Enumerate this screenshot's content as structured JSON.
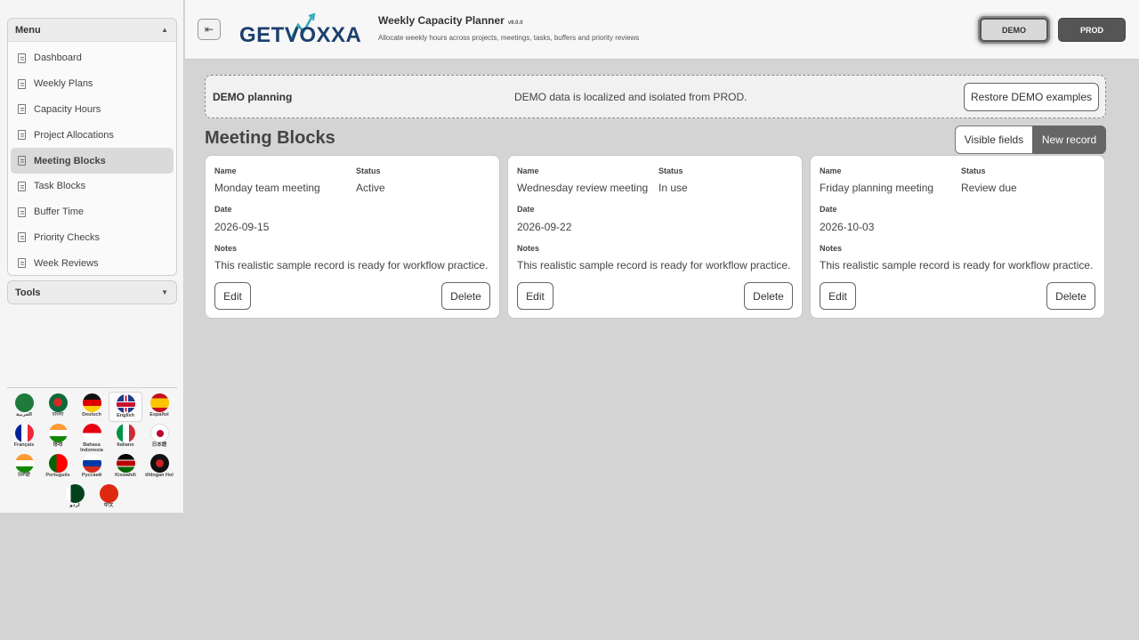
{
  "sidebar": {
    "menu_title": "Menu",
    "items": [
      {
        "label": "Dashboard"
      },
      {
        "label": "Weekly Plans"
      },
      {
        "label": "Capacity Hours"
      },
      {
        "label": "Project Allocations"
      },
      {
        "label": "Meeting Blocks",
        "active": true
      },
      {
        "label": "Task Blocks"
      },
      {
        "label": "Buffer Time"
      },
      {
        "label": "Priority Checks"
      },
      {
        "label": "Week Reviews"
      }
    ],
    "tools_title": "Tools",
    "languages": [
      {
        "name": "العربية",
        "icon": "flag-saudi-arabia-icon"
      },
      {
        "name": "বাংলা",
        "icon": "flag-bangladesh-icon"
      },
      {
        "name": "Deutsch",
        "icon": "flag-germany-icon"
      },
      {
        "name": "English",
        "icon": "flag-uk-icon",
        "selected": true
      },
      {
        "name": "Español",
        "icon": "flag-spain-icon"
      },
      {
        "name": "Français",
        "icon": "flag-france-icon"
      },
      {
        "name": "हिन्दी",
        "icon": "flag-india-icon"
      },
      {
        "name": "Bahasa Indonesia",
        "icon": "flag-indonesia-icon"
      },
      {
        "name": "Italiano",
        "icon": "flag-italy-icon"
      },
      {
        "name": "日本語",
        "icon": "flag-japan-icon"
      },
      {
        "name": "ਪੰਜਾਬੀ",
        "icon": "flag-india-icon"
      },
      {
        "name": "Português",
        "icon": "flag-portugal-icon"
      },
      {
        "name": "Русский",
        "icon": "flag-russia-icon"
      },
      {
        "name": "Kiswahili",
        "icon": "flag-kenya-icon"
      },
      {
        "name": "tlhIngan Hol",
        "icon": "flag-klingon-icon"
      },
      {
        "name": "اردو",
        "icon": "flag-pakistan-icon"
      },
      {
        "name": "中文",
        "icon": "flag-china-icon"
      }
    ]
  },
  "header": {
    "logo_text": "GETVOXXA",
    "app_title": "Weekly Capacity Planner",
    "version": "v9.0.0",
    "subtitle": "Allocate weekly hours across projects, meetings, tasks, buffers and priority reviews",
    "env_demo": "DEMO",
    "env_prod": "PROD"
  },
  "banner": {
    "title": "DEMO planning",
    "message": "DEMO data is localized and isolated from PROD.",
    "restore_label": "Restore DEMO examples"
  },
  "page": {
    "title": "Meeting Blocks",
    "visible_fields_label": "Visible fields",
    "new_record_label": "New record"
  },
  "labels": {
    "name": "Name",
    "status": "Status",
    "date": "Date",
    "notes": "Notes",
    "edit": "Edit",
    "delete": "Delete"
  },
  "records": [
    {
      "name": "Monday team meeting",
      "status": "Active",
      "date": "2026-09-15",
      "notes": "This realistic sample record is ready for workflow practice."
    },
    {
      "name": "Wednesday review meeting",
      "status": "In use",
      "date": "2026-09-22",
      "notes": "This realistic sample record is ready for workflow practice."
    },
    {
      "name": "Friday planning meeting",
      "status": "Review due",
      "date": "2026-10-03",
      "notes": "This realistic sample record is ready for workflow practice."
    }
  ],
  "colors": {
    "brand_navy": "#1d3f6e",
    "brand_teal": "#2aa8b8",
    "prod_button": "#555555",
    "new_record_button": "#666666"
  }
}
